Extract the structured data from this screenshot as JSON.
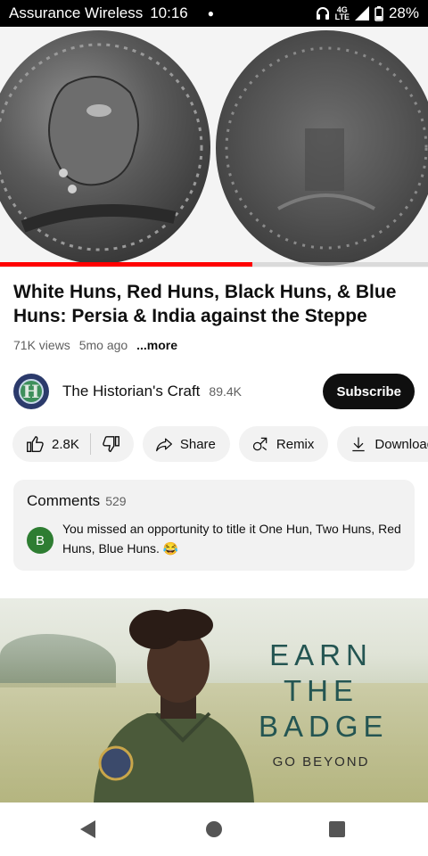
{
  "status_bar": {
    "carrier": "Assurance Wireless",
    "time": "10:16",
    "network_top": "4G",
    "network_bottom": "LTE",
    "battery": "28%"
  },
  "video": {
    "progress_fraction": 0.59
  },
  "video_info": {
    "title": "White Huns, Red Huns, Black Huns, & Blue Huns: Persia & India against the Steppe",
    "views": "71K views",
    "age": "5mo ago",
    "more": "...more"
  },
  "channel": {
    "name": "The Historian's Craft",
    "subscribers": "89.4K",
    "avatar_letter": "H",
    "subscribe_label": "Subscribe"
  },
  "actions": {
    "likes": "2.8K",
    "share": "Share",
    "remix": "Remix",
    "download": "Download"
  },
  "comments": {
    "header": "Comments",
    "count": "529",
    "top_comment": {
      "avatar_letter": "B",
      "text": "You missed an opportunity to title it One Hun, Two Huns, Red Huns, Blue Huns. 😂"
    }
  },
  "ad": {
    "headline_line1": "EARN",
    "headline_line2": "THE",
    "headline_line3": "BADGE",
    "subline": "GO BEYOND"
  },
  "colors": {
    "progress": "#ff0000",
    "subscribe_bg": "#0f0f0f",
    "pill_bg": "#f2f2f2",
    "comment_avatar": "#2e7d32"
  }
}
